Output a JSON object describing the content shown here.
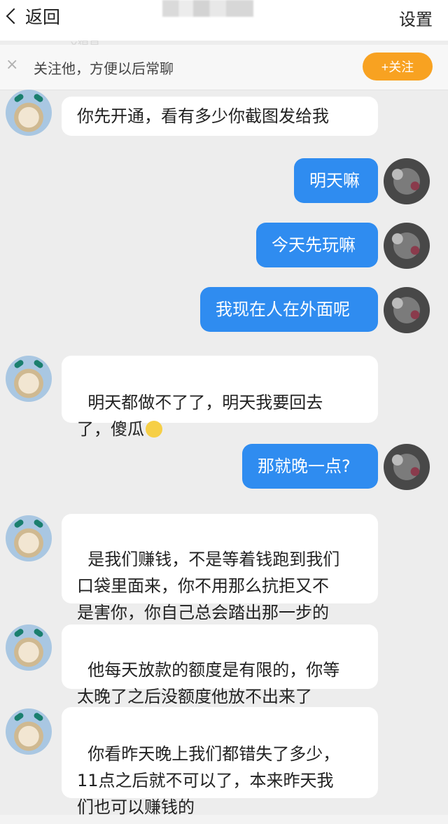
{
  "header": {
    "back_label": "返回",
    "settings_label": "设置",
    "faint_name": "X猩星"
  },
  "follow_prompt": {
    "close_glyph": "×",
    "text": "关注他，方便以后常聊",
    "button_label": "+关注"
  },
  "messages": [
    {
      "side": "left",
      "text": "你先开通，看有多少你截图发给我"
    },
    {
      "side": "right",
      "text": "明天嘛"
    },
    {
      "side": "right",
      "text": "今天先玩嘛"
    },
    {
      "side": "right",
      "text": "我现在人在外面呢"
    },
    {
      "side": "left",
      "text": "明天都做不了了，明天我要回去\n了，傻瓜",
      "emoji": "smirk-emoji"
    },
    {
      "side": "right",
      "text": "那就晚一点?"
    },
    {
      "side": "left",
      "text": "是我们赚钱，不是等着钱跑到我们\n口袋里面来，你不用那么抗拒又不\n是害你，你自己总会踏出那一步的"
    },
    {
      "side": "left",
      "text": "他每天放款的额度是有限的，你等\n太晚了之后没额度他放不出来了"
    },
    {
      "side": "left",
      "text": "你看昨天晚上我们都错失了多少，\n11点之后就不可以了，本来昨天我\n们也可以赚钱的"
    }
  ],
  "colors": {
    "accent_blue": "#2f8cf0",
    "follow_orange": "#f8a221",
    "background": "#ededed"
  }
}
